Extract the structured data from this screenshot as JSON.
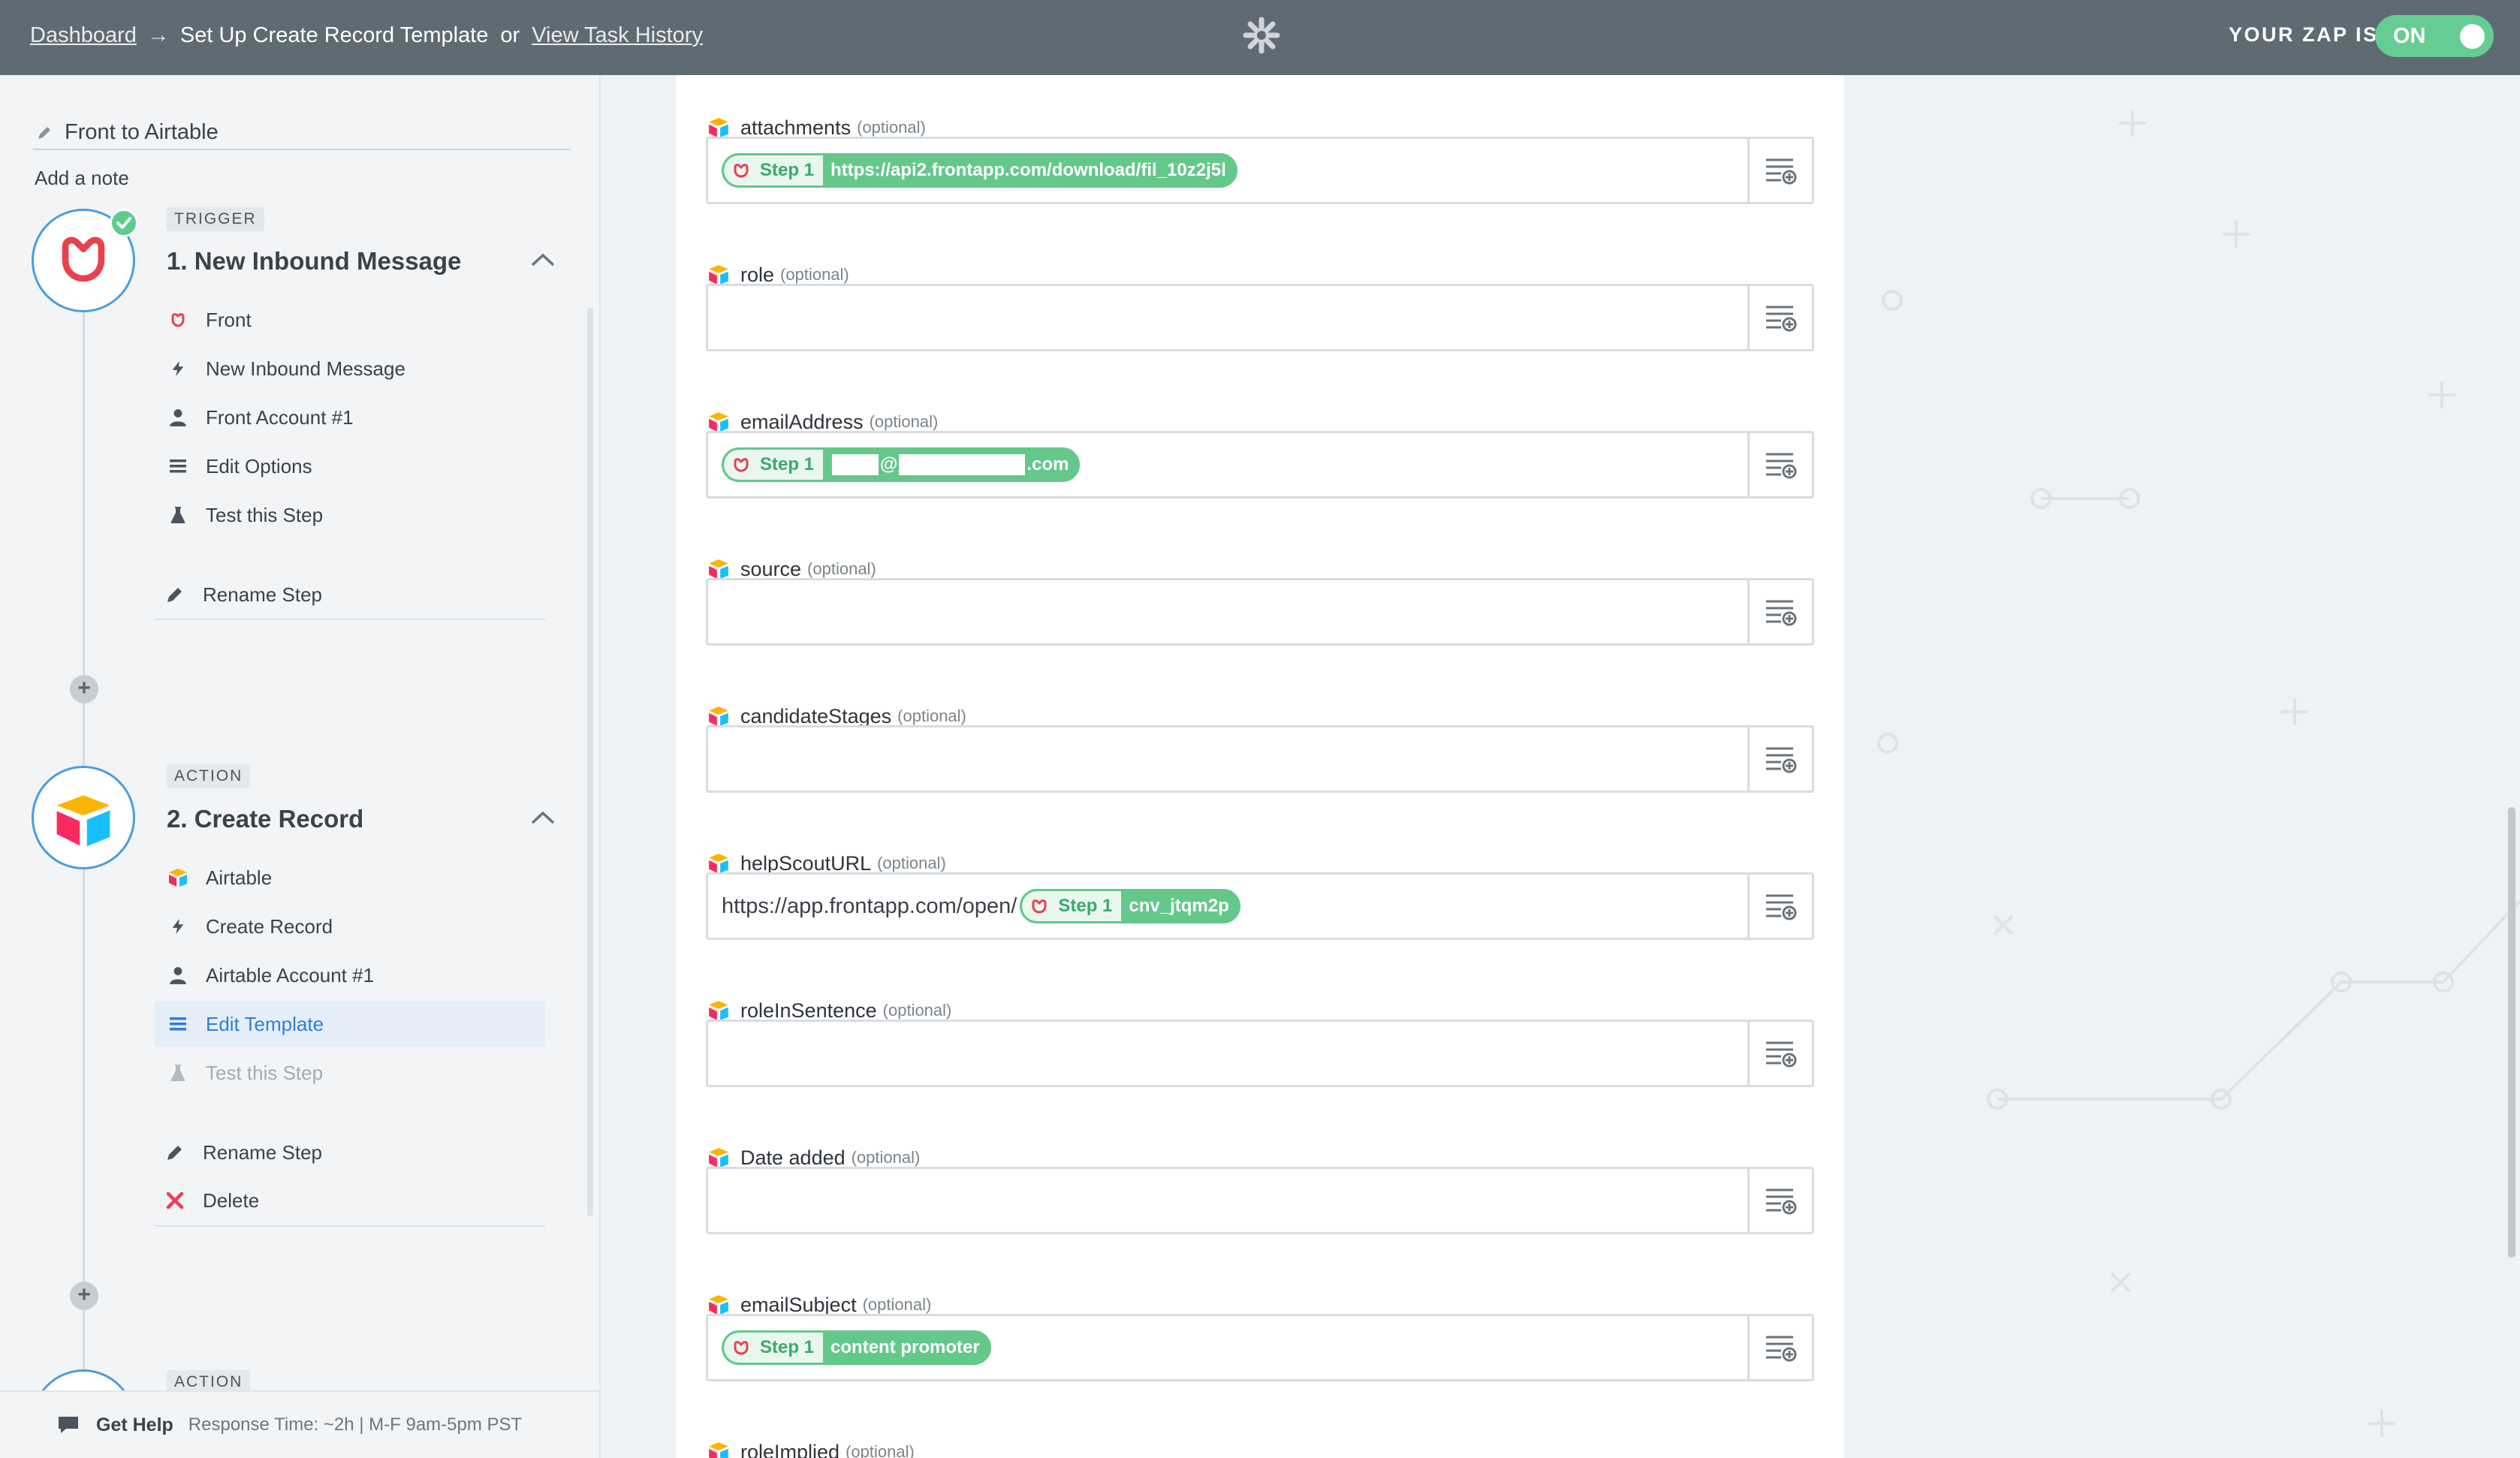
{
  "topbar": {
    "dashboard": "Dashboard",
    "arrow": "→",
    "current_page": "Set Up Create Record Template",
    "or": "or",
    "task_history": "View Task History",
    "zap_is_label": "YOUR ZAP IS",
    "zap_state": "ON"
  },
  "sidebar": {
    "zap_name": "Front to Airtable",
    "add_note": "Add a note",
    "steps": [
      {
        "badge": "TRIGGER",
        "title": "1. New Inbound Message",
        "items": {
          "app": "Front",
          "event": "New Inbound Message",
          "account": "Front Account #1",
          "options": "Edit Options",
          "test": "Test this Step",
          "rename": "Rename Step"
        }
      },
      {
        "badge": "ACTION",
        "title": "2. Create Record",
        "items": {
          "app": "Airtable",
          "event": "Create Record",
          "account": "Airtable Account #1",
          "template": "Edit Template",
          "test": "Test this Step",
          "rename": "Rename Step",
          "delete": "Delete"
        }
      },
      {
        "badge": "ACTION"
      }
    ],
    "help": {
      "label": "Get Help",
      "response_time": "Response Time: ~2h | M-F 9am-5pm PST"
    }
  },
  "form": {
    "optional": "(optional)",
    "fields": [
      {
        "label": "attachments",
        "pill_step": "Step 1",
        "pill_value": "https://api2.frontapp.com/download/fil_10z2j5l"
      },
      {
        "label": "role"
      },
      {
        "label": "emailAddress",
        "pill_step": "Step 1",
        "pill_at": "@",
        "pill_tail": ".com"
      },
      {
        "label": "source"
      },
      {
        "label": "candidateStages"
      },
      {
        "label": "helpScoutURL",
        "prefix": "https://app.frontapp.com/open/",
        "pill_step": "Step 1",
        "pill_value": "cnv_jtqm2p"
      },
      {
        "label": "roleInSentence"
      },
      {
        "label": "Date added"
      },
      {
        "label": "emailSubject",
        "pill_step": "Step 1",
        "pill_value": "content promoter"
      },
      {
        "label": "roleImplied"
      }
    ]
  },
  "colors": {
    "topbar": "#5f6b73",
    "accent_green": "#65cd94",
    "accent_blue": "#4a9de0",
    "front_red": "#e8414d"
  },
  "icons": {
    "zapier_logo": "asterisk-logo-icon",
    "field_app": "airtable-logo-icon",
    "insert_field": "list-plus-icon"
  }
}
